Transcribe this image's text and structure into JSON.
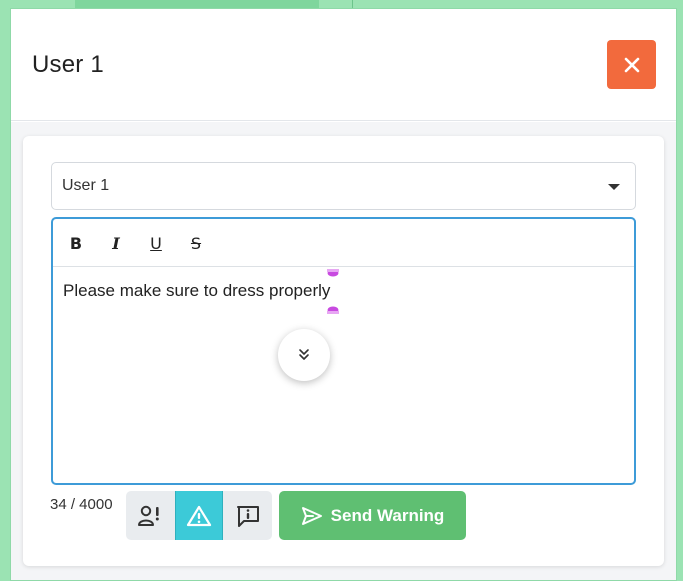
{
  "modal": {
    "title": "User 1",
    "close_icon": "close-icon"
  },
  "form": {
    "recipient_select": {
      "value": "User 1",
      "icon": "chevron-down-icon"
    },
    "editor": {
      "toolbar": [
        {
          "name": "bold",
          "label": "B"
        },
        {
          "name": "italic",
          "label": "I"
        },
        {
          "name": "underline",
          "label": "U"
        },
        {
          "name": "strikethrough",
          "label": "S"
        }
      ],
      "content": "Please make sure to dress properly",
      "scroll_icon": "double-chevron-down-icon"
    },
    "char_count": "34 / 4000",
    "type_buttons": [
      {
        "name": "user-alert",
        "icon": "user-exclamation-icon",
        "active": false
      },
      {
        "name": "warning",
        "icon": "warning-triangle-icon",
        "active": true
      },
      {
        "name": "info",
        "icon": "info-message-icon",
        "active": false
      }
    ],
    "send_button": {
      "label": "Send Warning",
      "icon": "send-icon"
    }
  },
  "colors": {
    "close": "#f26a3d",
    "send": "#5fbf72",
    "active_type": "#3ccad8",
    "editor_border": "#3d9bd8",
    "caret_handles": "#c84ae0"
  }
}
